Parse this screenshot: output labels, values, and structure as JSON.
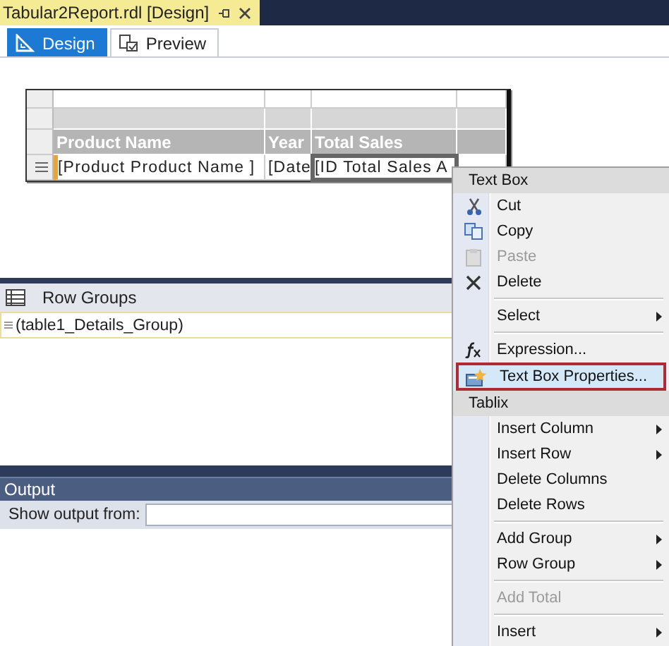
{
  "document_tab": {
    "title": "Tabular2Report.rdl [Design]"
  },
  "view_tabs": [
    {
      "label": "Design",
      "selected": true
    },
    {
      "label": "Preview",
      "selected": false
    }
  ],
  "table": {
    "columns": [
      "Product Name",
      "Year",
      "Total Sales"
    ],
    "cells": [
      {
        "text": "[Product Product Name ]",
        "selected": false
      },
      {
        "text": "[Date",
        "selected": false
      },
      {
        "text": "[ID Total Sales A",
        "selected": true
      }
    ]
  },
  "row_groups": {
    "title": "Row Groups",
    "items": [
      "(table1_Details_Group)"
    ]
  },
  "output": {
    "title": "Output",
    "show_output_label": "Show output from:"
  },
  "context_menu": {
    "items": [
      {
        "kind": "header",
        "label": "Text Box"
      },
      {
        "kind": "item",
        "label": "Cut",
        "disabled": false,
        "selected": false,
        "submenu": false
      },
      {
        "kind": "item",
        "label": "Copy",
        "disabled": false,
        "selected": false,
        "submenu": false
      },
      {
        "kind": "item",
        "label": "Paste",
        "disabled": true,
        "selected": false,
        "submenu": false
      },
      {
        "kind": "item",
        "label": "Delete",
        "disabled": false,
        "selected": false,
        "submenu": false
      },
      {
        "kind": "separator"
      },
      {
        "kind": "item",
        "label": "Select",
        "disabled": false,
        "selected": false,
        "submenu": true
      },
      {
        "kind": "separator"
      },
      {
        "kind": "item",
        "label": "Expression...",
        "disabled": false,
        "selected": false,
        "submenu": false
      },
      {
        "kind": "item",
        "label": "Text Box Properties...",
        "disabled": false,
        "selected": true,
        "submenu": false
      },
      {
        "kind": "header",
        "label": "Tablix"
      },
      {
        "kind": "item",
        "label": "Insert Column",
        "disabled": false,
        "selected": false,
        "submenu": true
      },
      {
        "kind": "item",
        "label": "Insert Row",
        "disabled": false,
        "selected": false,
        "submenu": true
      },
      {
        "kind": "item",
        "label": "Delete Columns",
        "disabled": false,
        "selected": false,
        "submenu": false
      },
      {
        "kind": "item",
        "label": "Delete Rows",
        "disabled": false,
        "selected": false,
        "submenu": false
      },
      {
        "kind": "separator"
      },
      {
        "kind": "item",
        "label": "Add Group",
        "disabled": false,
        "selected": false,
        "submenu": true
      },
      {
        "kind": "item",
        "label": "Row Group",
        "disabled": false,
        "selected": false,
        "submenu": true
      },
      {
        "kind": "separator"
      },
      {
        "kind": "item",
        "label": "Add Total",
        "disabled": true,
        "selected": false,
        "submenu": false
      },
      {
        "kind": "separator"
      },
      {
        "kind": "item",
        "label": "Insert",
        "disabled": false,
        "selected": false,
        "submenu": true
      }
    ]
  }
}
